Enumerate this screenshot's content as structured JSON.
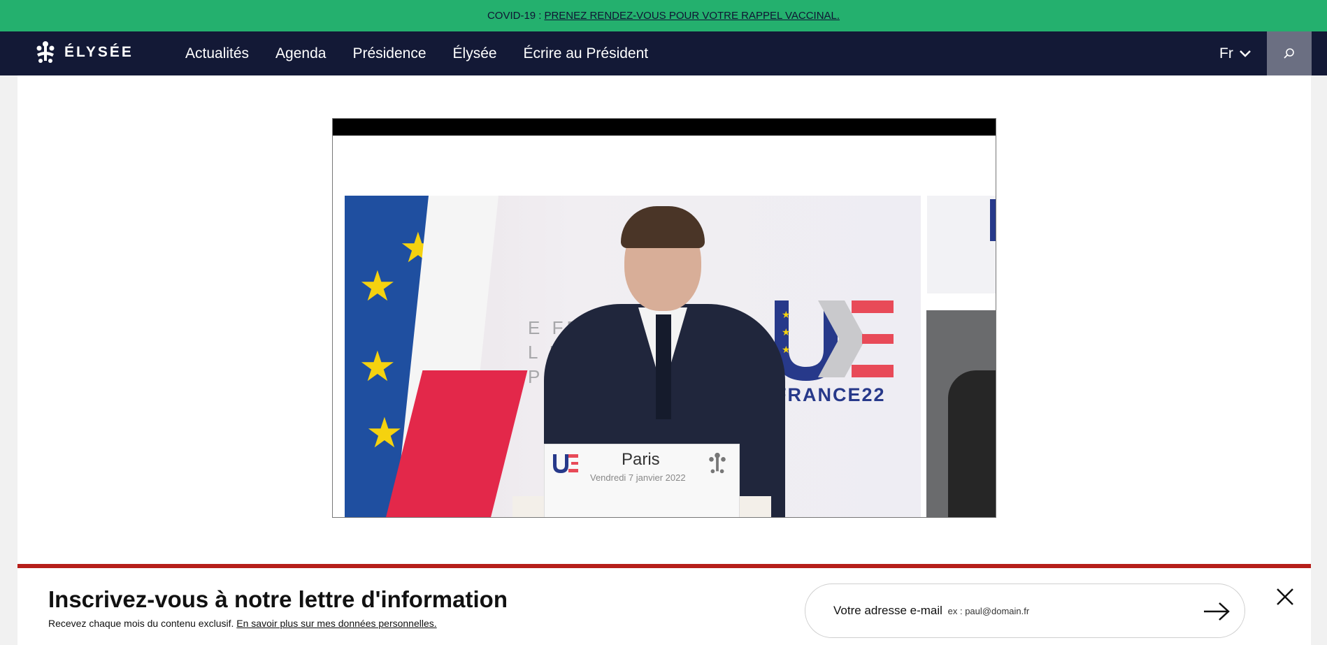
{
  "banner": {
    "prefix": "COVID-19 :",
    "link": "PRENEZ RENDEZ-VOUS POUR VOTRE RAPPEL VACCINAL."
  },
  "nav": {
    "logo_text": "ÉLYSÉE",
    "items": [
      "Actualités",
      "Agenda",
      "Présidence",
      "Élysée",
      "Écrire au Président"
    ],
    "lang": "Fr"
  },
  "video": {
    "podium_city": "Paris",
    "podium_date": "Vendredi 7 janvier 2022",
    "backdrop_text": [
      "E FRANC",
      "L DE",
      "PÉE"
    ],
    "logo_text": "FRANCE22"
  },
  "newsletter": {
    "title": "Inscrivez-vous à notre lettre d'information",
    "subtitle": "Recevez chaque mois du contenu exclusif.",
    "privacy_link": "En savoir plus sur mes données personnelles.",
    "email_label": "Votre adresse e-mail",
    "email_placeholder": "ex : paul@domain.fr"
  },
  "colors": {
    "banner": "#24b06e",
    "nav": "#131936",
    "newsletter_border": "#b61f1a"
  },
  "icons": [
    "elysee-logo-icon",
    "chevron-down-icon",
    "search-icon",
    "arrow-right-icon",
    "close-icon"
  ]
}
